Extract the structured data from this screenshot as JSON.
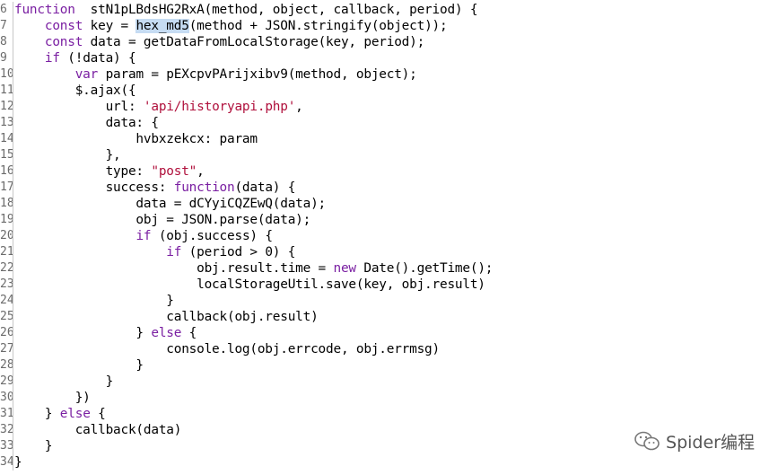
{
  "editor": {
    "line_numbers": [
      "6",
      "7",
      "8",
      "9",
      "10",
      "11",
      "12",
      "13",
      "14",
      "15",
      "16",
      "17",
      "18",
      "19",
      "20",
      "21",
      "22",
      "23",
      "24",
      "25",
      "26",
      "27",
      "28",
      "29",
      "30",
      "31",
      "32",
      "33",
      "34"
    ],
    "selected_token": "hex_md5",
    "lines": [
      [
        [
          "kw",
          "function"
        ],
        [
          "",
          "  stN1pLBdsHG2RxA(method, object, callback, period) {"
        ]
      ],
      [
        [
          "",
          "    "
        ],
        [
          "kw",
          "const"
        ],
        [
          "",
          " key = "
        ],
        [
          "sel",
          "hex_md5"
        ],
        [
          "",
          "(method + JSON.stringify(object));"
        ]
      ],
      [
        [
          "",
          "    "
        ],
        [
          "kw",
          "const"
        ],
        [
          "",
          " data = getDataFromLocalStorage(key, period);"
        ]
      ],
      [
        [
          "",
          "    "
        ],
        [
          "kw",
          "if"
        ],
        [
          "",
          " (!data) {"
        ]
      ],
      [
        [
          "",
          "        "
        ],
        [
          "kw",
          "var"
        ],
        [
          "",
          " param = pEXcpvPArijxibv9(method, object);"
        ]
      ],
      [
        [
          "",
          "        $.ajax({"
        ]
      ],
      [
        [
          "",
          "            url: "
        ],
        [
          "str",
          "'api/historyapi.php'"
        ],
        [
          "",
          ","
        ]
      ],
      [
        [
          "",
          "            data: {"
        ]
      ],
      [
        [
          "",
          "                hvbxzekcx: param"
        ]
      ],
      [
        [
          "",
          "            },"
        ]
      ],
      [
        [
          "",
          "            type: "
        ],
        [
          "str",
          "\"post\""
        ],
        [
          "",
          ","
        ]
      ],
      [
        [
          "",
          "            success: "
        ],
        [
          "kw",
          "function"
        ],
        [
          "",
          "(data) {"
        ]
      ],
      [
        [
          "",
          "                data = dCYyiCQZEwQ(data);"
        ]
      ],
      [
        [
          "",
          "                obj = JSON.parse(data);"
        ]
      ],
      [
        [
          "",
          "                "
        ],
        [
          "kw",
          "if"
        ],
        [
          "",
          " (obj.success) {"
        ]
      ],
      [
        [
          "",
          "                    "
        ],
        [
          "kw",
          "if"
        ],
        [
          "",
          " (period > 0) {"
        ]
      ],
      [
        [
          "",
          "                        obj.result.time = "
        ],
        [
          "kw",
          "new"
        ],
        [
          "",
          " Date().getTime();"
        ]
      ],
      [
        [
          "",
          "                        localStorageUtil.save(key, obj.result)"
        ]
      ],
      [
        [
          "",
          "                    }"
        ]
      ],
      [
        [
          "",
          "                    callback(obj.result)"
        ]
      ],
      [
        [
          "",
          "                } "
        ],
        [
          "kw",
          "else"
        ],
        [
          "",
          " {"
        ]
      ],
      [
        [
          "",
          "                    console.log(obj.errcode, obj.errmsg)"
        ]
      ],
      [
        [
          "",
          "                }"
        ]
      ],
      [
        [
          "",
          "            }"
        ]
      ],
      [
        [
          "",
          "        })"
        ]
      ],
      [
        [
          "",
          "    } "
        ],
        [
          "kw",
          "else"
        ],
        [
          "",
          " {"
        ]
      ],
      [
        [
          "",
          "        callback(data)"
        ]
      ],
      [
        [
          "",
          "    }"
        ]
      ],
      [
        [
          "",
          "}"
        ]
      ]
    ]
  },
  "watermark": {
    "icon": "wechat-icon",
    "text": "Spider编程"
  }
}
